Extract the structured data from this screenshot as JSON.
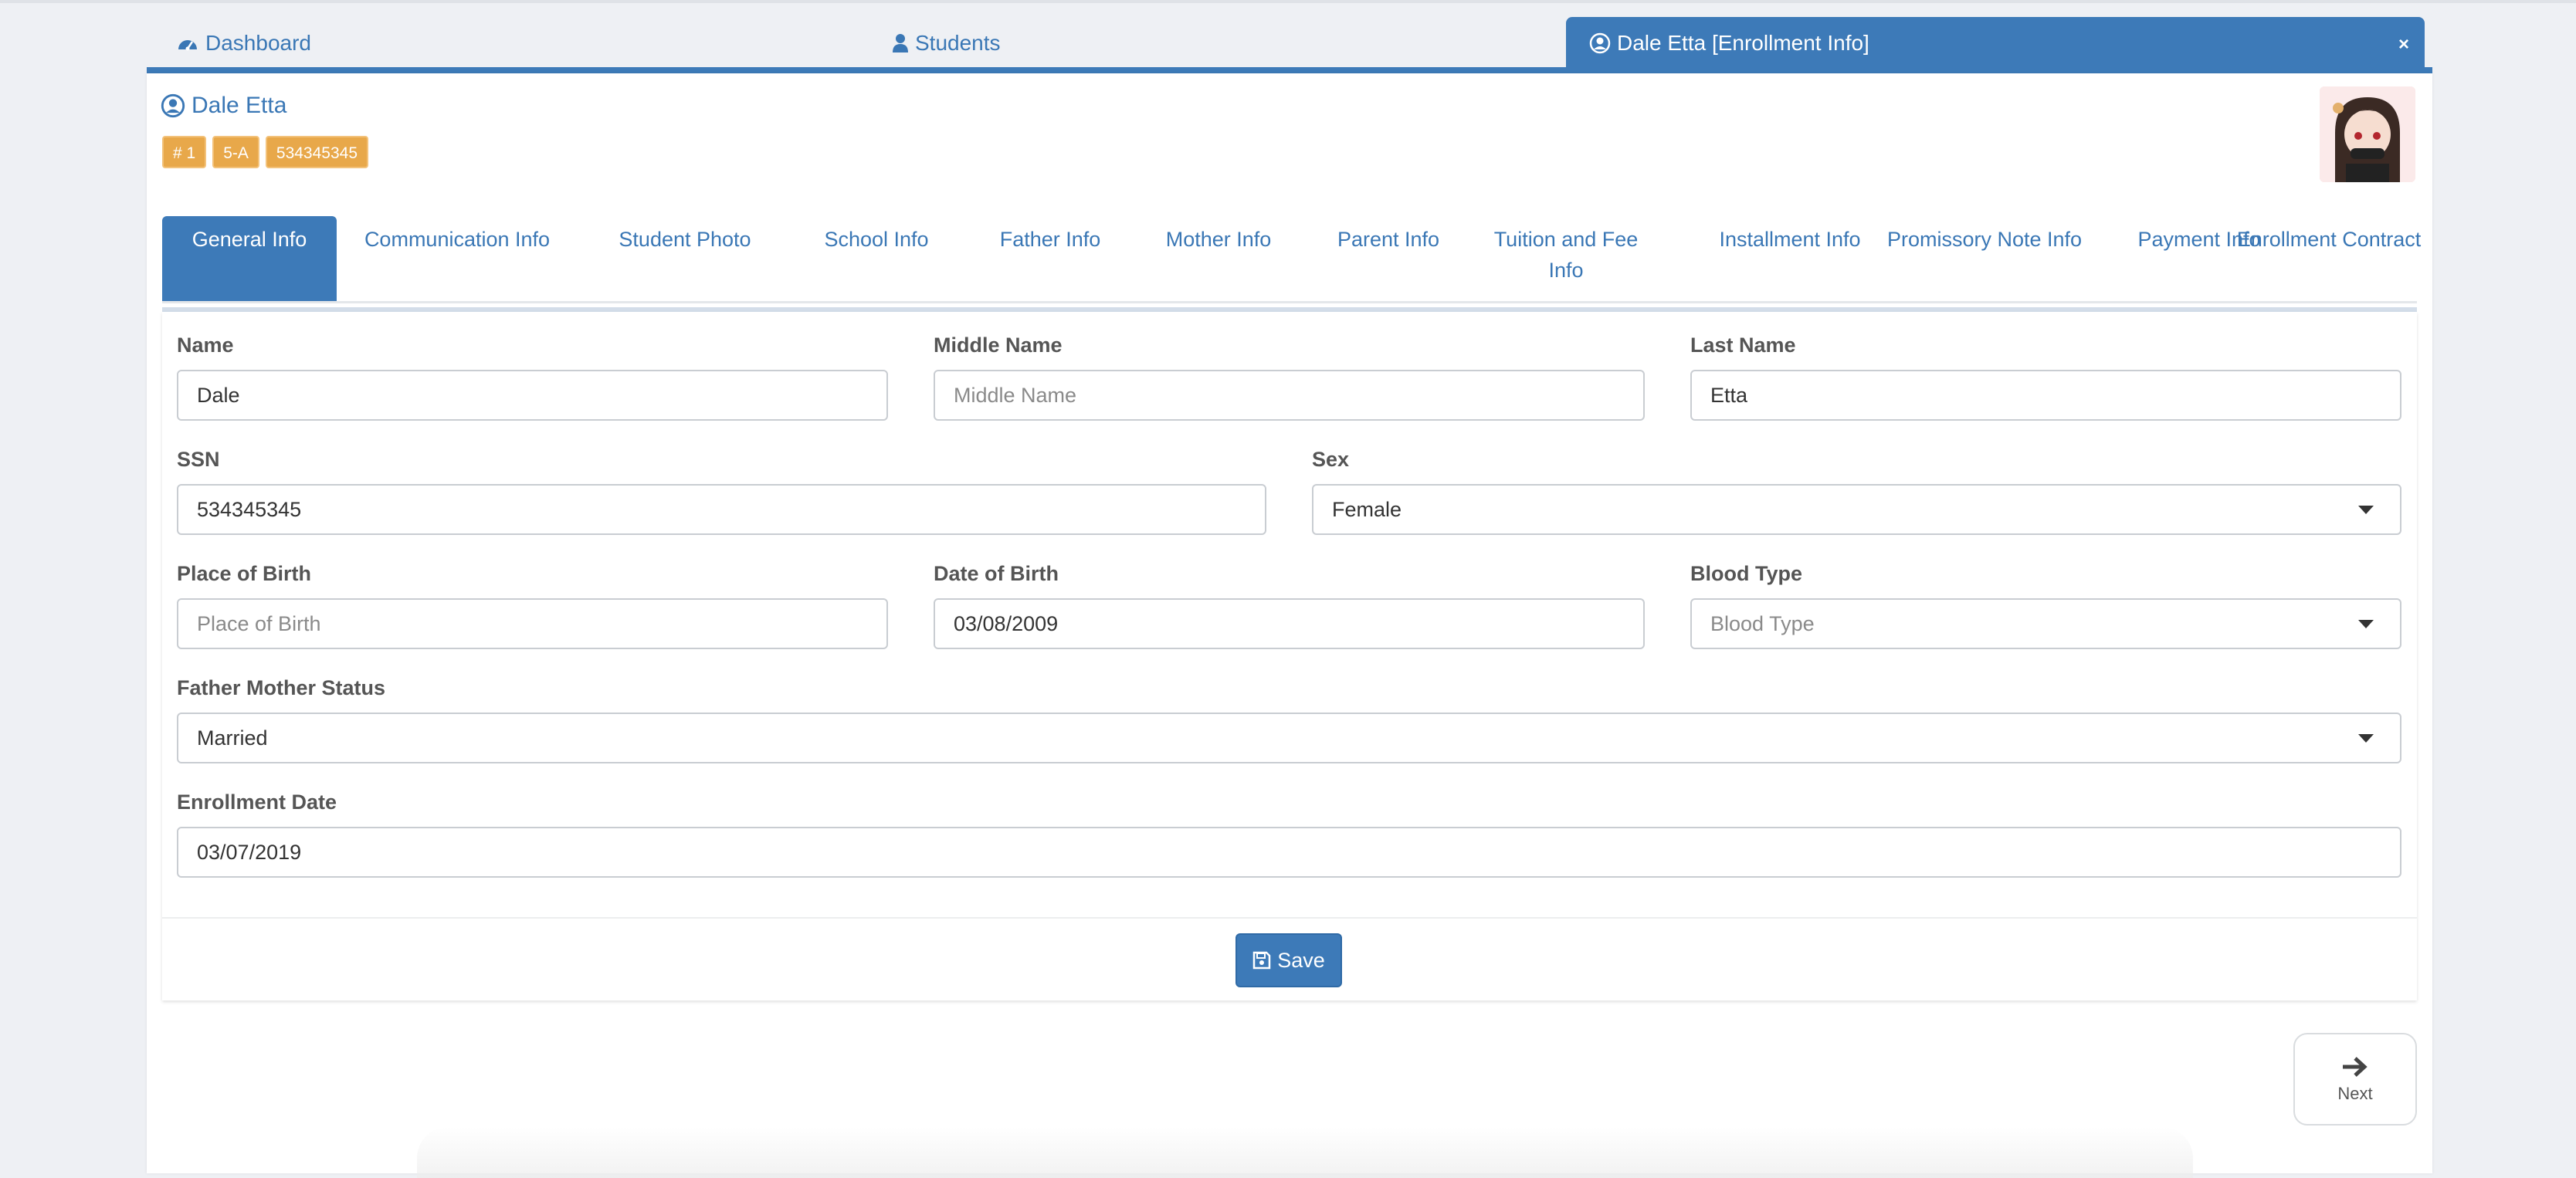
{
  "top_tabs": {
    "dashboard": "Dashboard",
    "students": "Students",
    "active": "Dale Etta [Enrollment Info]",
    "close": "×"
  },
  "student": {
    "name": "Dale Etta",
    "badges": [
      "# 1",
      "5-A",
      "534345345"
    ]
  },
  "subtabs": [
    "General Info",
    "Communication Info",
    "Student Photo",
    "School Info",
    "Father Info",
    "Mother Info",
    "Parent Info",
    "Tuition and Fee Info",
    "Installment Info",
    "Promissory Note Info",
    "Payment Info",
    "Enrollment Contract"
  ],
  "form": {
    "name": {
      "label": "Name",
      "value": "Dale"
    },
    "middle_name": {
      "label": "Middle Name",
      "placeholder": "Middle Name"
    },
    "last_name": {
      "label": "Last Name",
      "value": "Etta"
    },
    "ssn": {
      "label": "SSN",
      "value": "534345345"
    },
    "sex": {
      "label": "Sex",
      "value": "Female"
    },
    "place_of_birth": {
      "label": "Place of Birth",
      "placeholder": "Place of Birth"
    },
    "date_of_birth": {
      "label": "Date of Birth",
      "value": "03/08/2009"
    },
    "blood_type": {
      "label": "Blood Type",
      "placeholder": "Blood Type"
    },
    "father_mother_status": {
      "label": "Father Mother Status",
      "value": "Married"
    },
    "enrollment_date": {
      "label": "Enrollment Date",
      "value": "03/07/2019"
    }
  },
  "buttons": {
    "save": "Save",
    "next": "Next"
  },
  "icons": {
    "dashboard": "dashboard-icon",
    "students": "user-icon",
    "active": "user-circle-icon",
    "save": "floppy-disk-icon",
    "next": "arrow-right-icon"
  },
  "colors": {
    "primary": "#3d7ab8",
    "badge": "#e8a84a"
  }
}
